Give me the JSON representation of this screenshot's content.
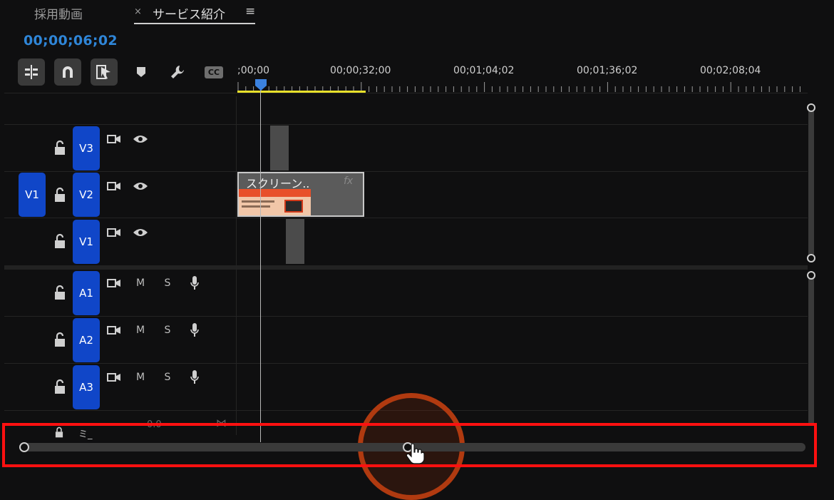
{
  "tabs": [
    {
      "label": "採用動画",
      "active": false
    },
    {
      "label": "サービス紹介",
      "active": true
    }
  ],
  "timecode": "00;00;06;02",
  "toolbar": {
    "icons": [
      "insert-snap-icon",
      "magnet-icon",
      "linked-selection-icon",
      "marker-icon",
      "wrench-icon",
      "captions-icon"
    ],
    "captions_label": "CC"
  },
  "ruler": {
    "labels": [
      ";00;00",
      "00;00;32;00",
      "00;01;04;02",
      "00;01;36;02",
      "00;02;08;04"
    ]
  },
  "video_tracks": [
    {
      "label": "V3",
      "source_patch": ""
    },
    {
      "label": "V2",
      "source_patch": "V1"
    },
    {
      "label": "V1",
      "source_patch": ""
    }
  ],
  "audio_tracks": [
    {
      "label": "A1",
      "mute": "M",
      "solo": "S"
    },
    {
      "label": "A2",
      "mute": "M",
      "solo": "S"
    },
    {
      "label": "A3",
      "mute": "M",
      "solo": "S"
    }
  ],
  "mix_track": {
    "label": "ミ_",
    "value": "0.0"
  },
  "clip": {
    "name": "スクリーン..",
    "fx": "fx"
  },
  "colors": {
    "track_blue": "#1046c8",
    "timecode_blue": "#2f86d8",
    "work_area_yellow": "#e8e02a",
    "highlight_red": "#ff1010",
    "click_ring_orange": "#b03a10"
  }
}
